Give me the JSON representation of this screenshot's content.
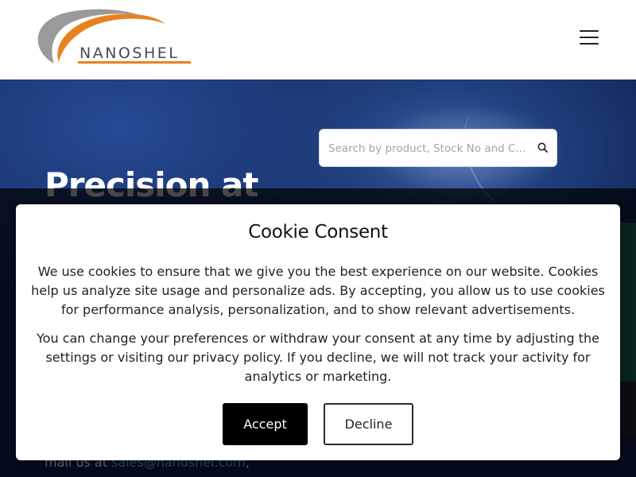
{
  "header": {
    "logo_text": "NANOSHEL",
    "menu_icon": "hamburger-menu-icon"
  },
  "hero": {
    "search_placeholder": "Search by product, Stock No and C...",
    "search_icon": "search-icon",
    "title": "Precision at",
    "mail_prefix": "mail us at ",
    "mail_link": "sales@nanoshel.com",
    "mail_suffix": ","
  },
  "cookie": {
    "title": "Cookie Consent",
    "paragraph1": "We use cookies to ensure that we give you the best experience on our website. Cookies help us analyze site usage and personalize ads. By accepting, you allow us to use cookies for performance analysis, personalization, and to show relevant advertisements.",
    "paragraph2": "You can change your preferences or withdraw your consent at any time by adjusting the settings or visiting our privacy policy. If you decline, we will not track your activity for analytics or marketing.",
    "accept_label": "Accept",
    "decline_label": "Decline"
  },
  "colors": {
    "logo_orange": "#e8821e",
    "logo_gray": "#9a9a9a",
    "hero_blue": "#1a3572",
    "accept_bg": "#000000"
  }
}
